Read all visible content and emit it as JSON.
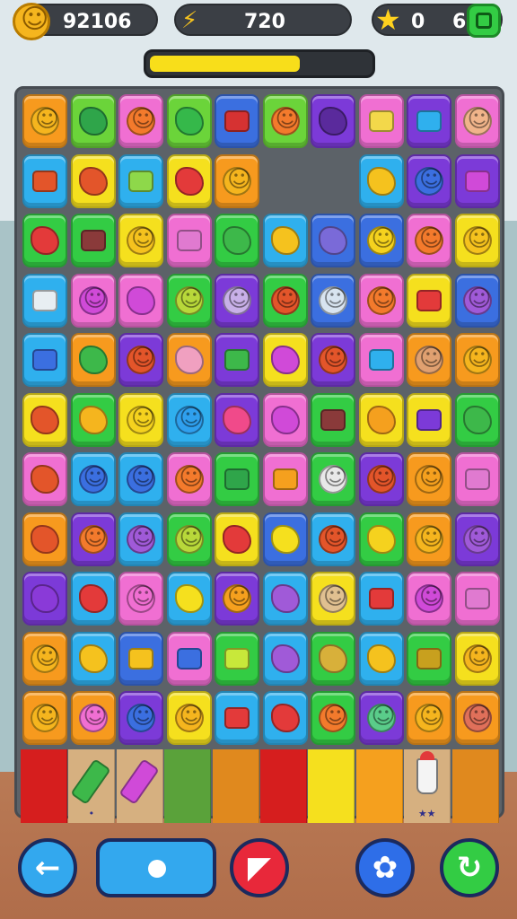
{
  "hud": {
    "coins": "92106",
    "energy": "720",
    "stars": "0",
    "moves": "6",
    "coin_icon": "smiley-coin-icon",
    "energy_icon": "lightning-icon",
    "star_icon": "star-icon",
    "menu_icon": "green-square-button-icon"
  },
  "progress": {
    "fraction": 0.68,
    "color": "#f8de1a"
  },
  "board": {
    "columns": 10,
    "rows": [
      [
        [
          "#f79a1e",
          "face",
          "#f5b51e"
        ],
        [
          "#6bd43a",
          "blob",
          "#2fa54a"
        ],
        [
          "#f06fd2",
          "face",
          "#f37a2c"
        ],
        [
          "#6bd43a",
          "blob",
          "#35b84a"
        ],
        [
          "#3b6fe0",
          "sq",
          "#d63232"
        ],
        [
          "#6bd43a",
          "face",
          "#f37a2c"
        ],
        [
          "#7c3ad8",
          "blob",
          "#5a2a9c"
        ],
        [
          "#f06fd2",
          "sq",
          "#f3d84a"
        ],
        [
          "#7c3ad8",
          "sq",
          "#2fb0ee"
        ],
        [
          "#f06fd2",
          "face",
          "#f0b48a"
        ]
      ],
      [
        [
          "#2fb0ee",
          "sq",
          "#e3552a"
        ],
        [
          "#f5e01e",
          "blob",
          "#e3552a"
        ],
        [
          "#2fb0ee",
          "sq",
          "#8ed84a"
        ],
        [
          "#f5e01e",
          "blob",
          "#e33a3a"
        ],
        [
          "#f79a1e",
          "face",
          "#f5b51e"
        ],
        null,
        null,
        [
          "#2fb0ee",
          "blob",
          "#f5c21e"
        ],
        [
          "#7c3ad8",
          "face",
          "#3b6fe0"
        ],
        [
          "#7c3ad8",
          "sq",
          "#d04ad8"
        ]
      ],
      [
        [
          "#33cc44",
          "blob",
          "#e33a3a"
        ],
        [
          "#33cc44",
          "sq",
          "#8a3a3a"
        ],
        [
          "#f5e01e",
          "face",
          "#f5c21e"
        ],
        [
          "#f06fd2",
          "sq",
          "#e07ad0"
        ],
        [
          "#33cc44",
          "blob",
          "#3db84a"
        ],
        [
          "#2fb0ee",
          "blob",
          "#f5c21e"
        ],
        [
          "#3b6fe0",
          "blob",
          "#7a6ad8"
        ],
        [
          "#3b6fe0",
          "face",
          "#f5d21e"
        ],
        [
          "#f06fd2",
          "face",
          "#f37a2c"
        ],
        [
          "#f5e01e",
          "face",
          "#f5c21e"
        ]
      ],
      [
        [
          "#2fb0ee",
          "sq",
          "#e8eef2"
        ],
        [
          "#f06fd2",
          "face",
          "#d04ad8"
        ],
        [
          "#f06fd2",
          "blob",
          "#d04ad8"
        ],
        [
          "#33cc44",
          "face",
          "#b8d83a"
        ],
        [
          "#7c3ad8",
          "face",
          "#c8b0e8"
        ],
        [
          "#33cc44",
          "face",
          "#e3552a"
        ],
        [
          "#3b6fe0",
          "face",
          "#d8e4f0"
        ],
        [
          "#f06fd2",
          "face",
          "#f37a2c"
        ],
        [
          "#f5e01e",
          "sq",
          "#e33a3a"
        ],
        [
          "#3b6fe0",
          "face",
          "#a05ad8"
        ]
      ],
      [
        [
          "#2fb0ee",
          "sq",
          "#3b6fe0"
        ],
        [
          "#f79a1e",
          "blob",
          "#3db84a"
        ],
        [
          "#7c3ad8",
          "face",
          "#e3552a"
        ],
        [
          "#f79a1e",
          "blob",
          "#f0a0c0"
        ],
        [
          "#7c3ad8",
          "sq",
          "#3db84a"
        ],
        [
          "#f5e01e",
          "blob",
          "#d04ad8"
        ],
        [
          "#7c3ad8",
          "face",
          "#e3552a"
        ],
        [
          "#f06fd2",
          "sq",
          "#2fb0ee"
        ],
        [
          "#f79a1e",
          "face",
          "#e0a070"
        ],
        [
          "#f79a1e",
          "face",
          "#f5b51e"
        ]
      ],
      [
        [
          "#f5e01e",
          "blob",
          "#e3552a"
        ],
        [
          "#33cc44",
          "blob",
          "#f5b51e"
        ],
        [
          "#f5e01e",
          "face",
          "#f5d21e"
        ],
        [
          "#2fb0ee",
          "face",
          "#2fa0ee"
        ],
        [
          "#7c3ad8",
          "blob",
          "#f04a8a"
        ],
        [
          "#f06fd2",
          "blob",
          "#d04ad8"
        ],
        [
          "#33cc44",
          "sq",
          "#8a3a3a"
        ],
        [
          "#f5e01e",
          "blob",
          "#f5a01e"
        ],
        [
          "#f5e01e",
          "sq",
          "#7c3ad8"
        ],
        [
          "#33cc44",
          "blob",
          "#3db84a"
        ]
      ],
      [
        [
          "#f06fd2",
          "blob",
          "#e3552a"
        ],
        [
          "#2fb0ee",
          "face",
          "#3b6fe0"
        ],
        [
          "#2fb0ee",
          "face",
          "#3b6fe0"
        ],
        [
          "#f06fd2",
          "face",
          "#f37a2c"
        ],
        [
          "#33cc44",
          "sq",
          "#2fa54a"
        ],
        [
          "#f06fd2",
          "sq",
          "#f5a01e"
        ],
        [
          "#33cc44",
          "face",
          "#e8e8e8"
        ],
        [
          "#7c3ad8",
          "face",
          "#e3552a"
        ],
        [
          "#f79a1e",
          "face",
          "#f5a01e"
        ],
        [
          "#f06fd2",
          "sq",
          "#e07ad0"
        ]
      ],
      [
        [
          "#f79a1e",
          "blob",
          "#e3552a"
        ],
        [
          "#7c3ad8",
          "face",
          "#f37a2c"
        ],
        [
          "#2fb0ee",
          "face",
          "#a05ad8"
        ],
        [
          "#33cc44",
          "face",
          "#b8d83a"
        ],
        [
          "#f5e01e",
          "blob",
          "#e33a3a"
        ],
        [
          "#3b6fe0",
          "blob",
          "#f5e01e"
        ],
        [
          "#2fb0ee",
          "face",
          "#e3552a"
        ],
        [
          "#33cc44",
          "blob",
          "#f5d21e"
        ],
        [
          "#f79a1e",
          "face",
          "#f5b51e"
        ],
        [
          "#7c3ad8",
          "face",
          "#a05ad8"
        ]
      ],
      [
        [
          "#7c3ad8",
          "blob",
          "#8a3ad8"
        ],
        [
          "#2fb0ee",
          "blob",
          "#e33a3a"
        ],
        [
          "#f06fd2",
          "face",
          "#f06fd2"
        ],
        [
          "#2fb0ee",
          "blob",
          "#f5e01e"
        ],
        [
          "#7c3ad8",
          "face",
          "#f5a01e"
        ],
        [
          "#2fb0ee",
          "blob",
          "#a05ad8"
        ],
        [
          "#f5e01e",
          "face",
          "#e0c090"
        ],
        [
          "#2fb0ee",
          "sq",
          "#e33a3a"
        ],
        [
          "#f06fd2",
          "face",
          "#d04ad8"
        ],
        [
          "#f06fd2",
          "sq",
          "#e07ad0"
        ]
      ],
      [
        [
          "#f79a1e",
          "face",
          "#f5b51e"
        ],
        [
          "#2fb0ee",
          "blob",
          "#f5c21e"
        ],
        [
          "#3b6fe0",
          "sq",
          "#f5c21e"
        ],
        [
          "#f06fd2",
          "sq",
          "#3b6fe0"
        ],
        [
          "#33cc44",
          "sq",
          "#c8e83a"
        ],
        [
          "#2fb0ee",
          "blob",
          "#a05ad8"
        ],
        [
          "#33cc44",
          "blob",
          "#d8b03a"
        ],
        [
          "#2fb0ee",
          "blob",
          "#f5c21e"
        ],
        [
          "#33cc44",
          "sq",
          "#c8a01e"
        ],
        [
          "#f5e01e",
          "face",
          "#f5b51e"
        ]
      ],
      [
        [
          "#f79a1e",
          "face",
          "#f5b51e"
        ],
        [
          "#f79a1e",
          "face",
          "#f06fd2"
        ],
        [
          "#7c3ad8",
          "face",
          "#3b6fe0"
        ],
        [
          "#f5e01e",
          "face",
          "#f5b51e"
        ],
        [
          "#2fb0ee",
          "sq",
          "#e33a3a"
        ],
        [
          "#2fb0ee",
          "blob",
          "#e33a3a"
        ],
        [
          "#33cc44",
          "face",
          "#f37a2c"
        ],
        [
          "#7c3ad8",
          "face",
          "#5acc8a"
        ],
        [
          "#f79a1e",
          "face",
          "#f5b51e"
        ],
        [
          "#f79a1e",
          "face",
          "#e0705a"
        ]
      ]
    ],
    "bottom_row": [
      {
        "bg": "#d61e1e",
        "item": null
      },
      {
        "bg": "#d6b080",
        "item": "crayon",
        "color": "#3db84a",
        "mini": "•"
      },
      {
        "bg": "#d6b080",
        "item": "crayon",
        "color": "#d04ad8",
        "mini": ""
      },
      {
        "bg": "#5aa23a",
        "item": null
      },
      {
        "bg": "#e0891e",
        "item": null
      },
      {
        "bg": "#d61e1e",
        "item": null
      },
      {
        "bg": "#f5e01e",
        "item": null
      },
      {
        "bg": "#f5a01e",
        "item": null
      },
      {
        "bg": "#d6b080",
        "item": "cup",
        "mini": "★★"
      },
      {
        "bg": "#e0891e",
        "item": null
      }
    ]
  },
  "controls": [
    {
      "name": "back-button",
      "icon": "arrow-left-icon",
      "glyph": "←",
      "color": "#33a8ee"
    },
    {
      "name": "hammer-button",
      "icon": "triangle-icon",
      "glyph": "◤",
      "color": "#e8283a"
    },
    {
      "name": "shuffle-button",
      "icon": "gear-blue-icon",
      "glyph": "✿",
      "color": "#2e6ee8"
    },
    {
      "name": "refresh-button",
      "icon": "refresh-icon",
      "glyph": "↻",
      "color": "#33cc44"
    }
  ]
}
